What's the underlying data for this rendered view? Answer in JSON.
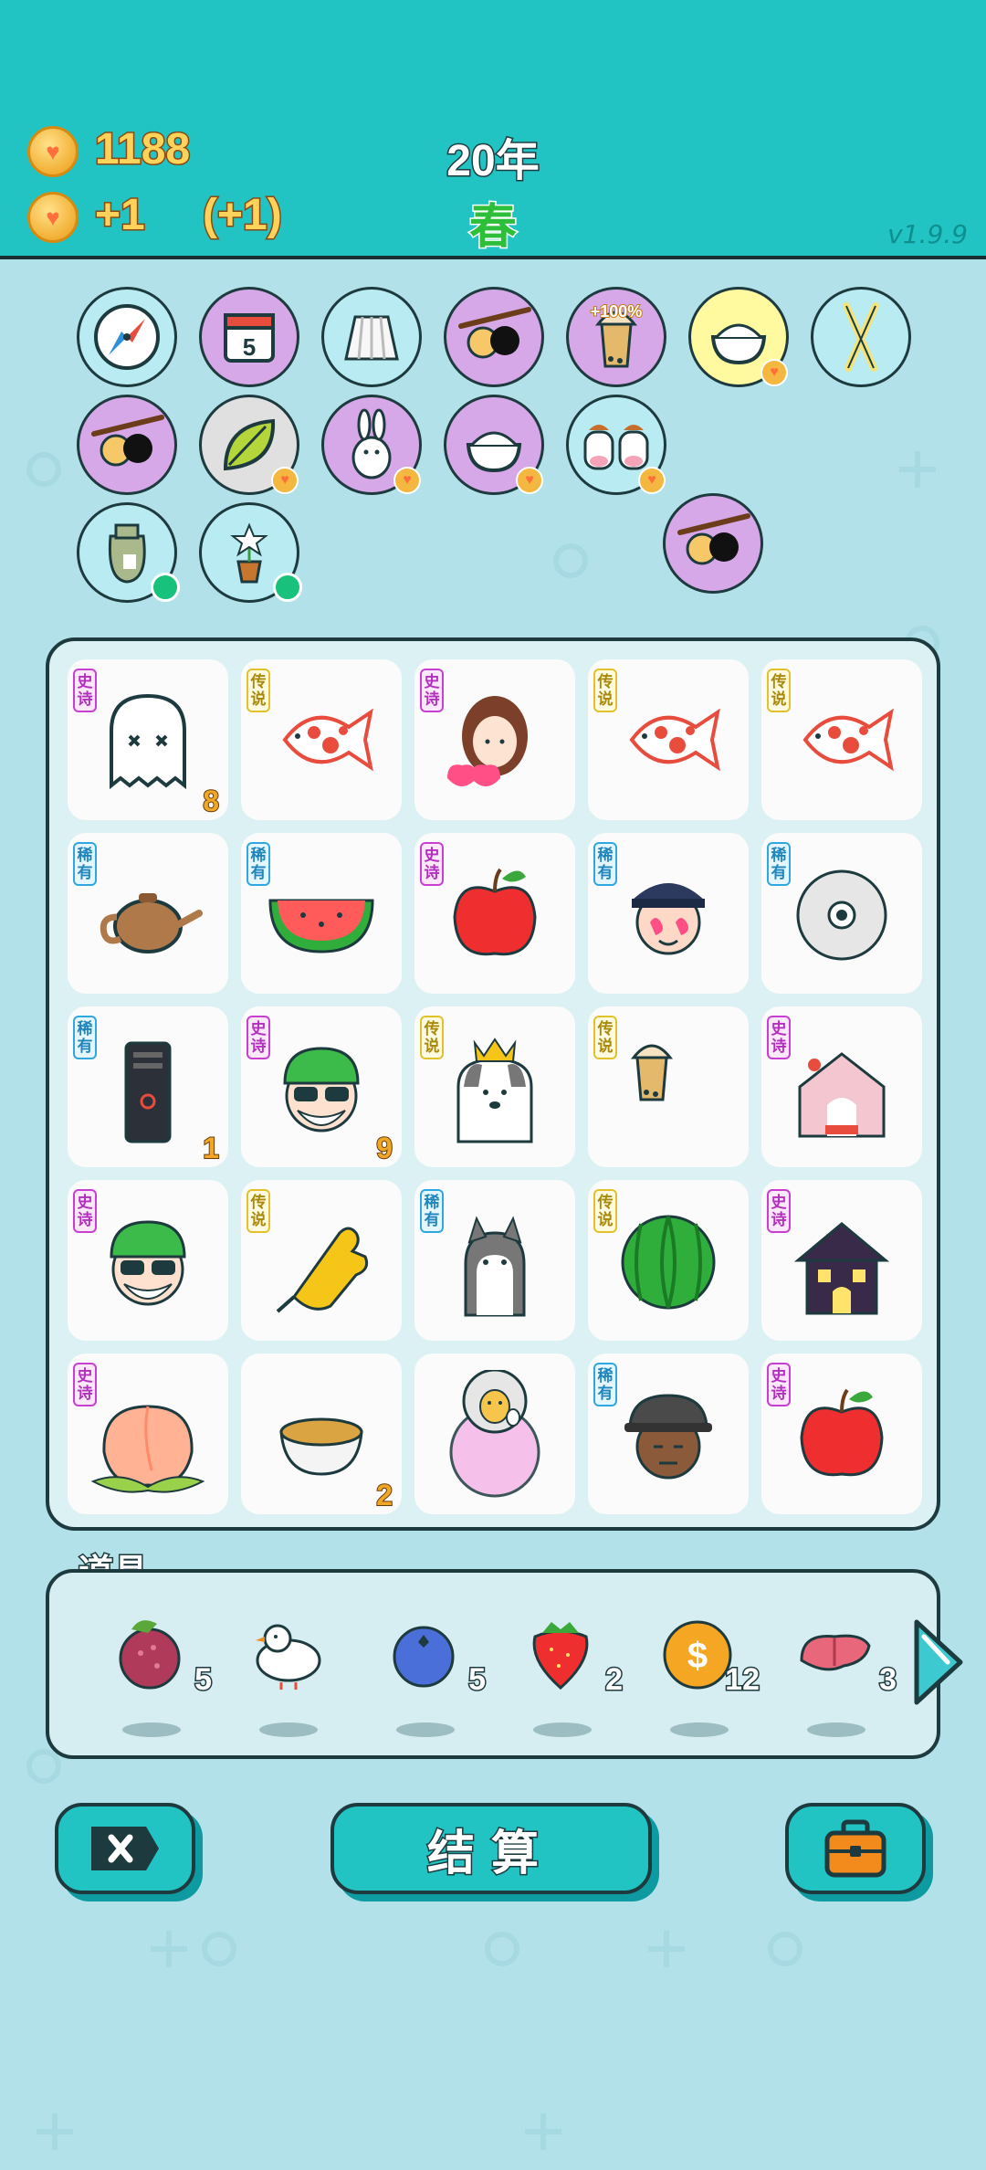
{
  "header": {
    "coins": "1188",
    "income": "+1",
    "income_bonus": "(+1)",
    "year": "20年",
    "season": "春",
    "version": "v1.9.9"
  },
  "buffs": [
    {
      "name": "compass",
      "bg": "#b9ecf2"
    },
    {
      "name": "calendar",
      "bg": "#d7a8e8",
      "label": "5"
    },
    {
      "name": "skirt",
      "bg": "#b9ecf2"
    },
    {
      "name": "eyepatch-ball",
      "bg": "#d7a8e8"
    },
    {
      "name": "bubble-tea",
      "bg": "#d7a8e8",
      "label": "+100%"
    },
    {
      "name": "rice-bowl",
      "bg": "#fffaa0",
      "heart": true
    },
    {
      "name": "chopsticks",
      "bg": "#b9ecf2"
    },
    {
      "name": "eyepatch-ball",
      "bg": "#d7a8e8"
    },
    {
      "name": "leaf",
      "bg": "#e0e0e0",
      "heart": true
    },
    {
      "name": "rabbit",
      "bg": "#d7a8e8",
      "heart": true
    },
    {
      "name": "rice-bowl",
      "bg": "#d7a8e8",
      "heart": true
    },
    {
      "name": "cows",
      "bg": "#b9ecf2",
      "heart": true
    },
    {
      "name": "sack",
      "bg": "#b9ecf2",
      "dot": true
    },
    {
      "name": "flower-pot",
      "bg": "#b9ecf2",
      "dot": true
    },
    {
      "name": "eyepatch-ball",
      "bg": "#d7a8e8"
    }
  ],
  "rarity_labels": {
    "epic": "史诗",
    "legend": "传说",
    "rare": "稀有"
  },
  "board": [
    {
      "icon": "ghost",
      "rarity": "epic",
      "count": "8"
    },
    {
      "icon": "koi",
      "rarity": "legend",
      "count": ""
    },
    {
      "icon": "girl",
      "rarity": "epic",
      "count": ""
    },
    {
      "icon": "koi",
      "rarity": "legend",
      "count": ""
    },
    {
      "icon": "koi",
      "rarity": "legend",
      "count": ""
    },
    {
      "icon": "teapot",
      "rarity": "rare",
      "count": ""
    },
    {
      "icon": "watermelon-slice",
      "rarity": "rare",
      "count": ""
    },
    {
      "icon": "apple",
      "rarity": "epic",
      "count": ""
    },
    {
      "icon": "police-face",
      "rarity": "rare",
      "count": ""
    },
    {
      "icon": "cd",
      "rarity": "rare",
      "count": ""
    },
    {
      "icon": "pc-tower",
      "rarity": "rare",
      "count": "1"
    },
    {
      "icon": "green-hat-face",
      "rarity": "epic",
      "count": "9"
    },
    {
      "icon": "husky-king",
      "rarity": "legend",
      "count": ""
    },
    {
      "icon": "bubble-tea",
      "rarity": "legend",
      "count": ""
    },
    {
      "icon": "pet-house",
      "rarity": "epic",
      "count": ""
    },
    {
      "icon": "green-hat-face",
      "rarity": "epic",
      "count": ""
    },
    {
      "icon": "pointing-hand",
      "rarity": "legend",
      "count": ""
    },
    {
      "icon": "husky",
      "rarity": "rare",
      "count": ""
    },
    {
      "icon": "watermelon",
      "rarity": "legend",
      "count": ""
    },
    {
      "icon": "haunted-house",
      "rarity": "epic",
      "count": ""
    },
    {
      "icon": "peach",
      "rarity": "epic",
      "count": ""
    },
    {
      "icon": "bowl",
      "rarity": "",
      "count": "2"
    },
    {
      "icon": "chick-globe",
      "rarity": "",
      "count": ""
    },
    {
      "icon": "bucket-hat-man",
      "rarity": "rare",
      "count": ""
    },
    {
      "icon": "apple",
      "rarity": "epic",
      "count": ""
    }
  ],
  "items_title": "道具",
  "items": [
    {
      "icon": "lychee",
      "count": "5"
    },
    {
      "icon": "dove",
      "count": ""
    },
    {
      "icon": "blueberry",
      "count": "5"
    },
    {
      "icon": "strawberry",
      "count": "2"
    },
    {
      "icon": "coin-dollar",
      "count": "12"
    },
    {
      "icon": "liver",
      "count": "3"
    }
  ],
  "buttons": {
    "settle": "结算"
  },
  "colors": {
    "accent": "#21c3c3",
    "outline": "#1d3a3e",
    "coin": "#ffd25a",
    "season": "#2dbf3a"
  }
}
